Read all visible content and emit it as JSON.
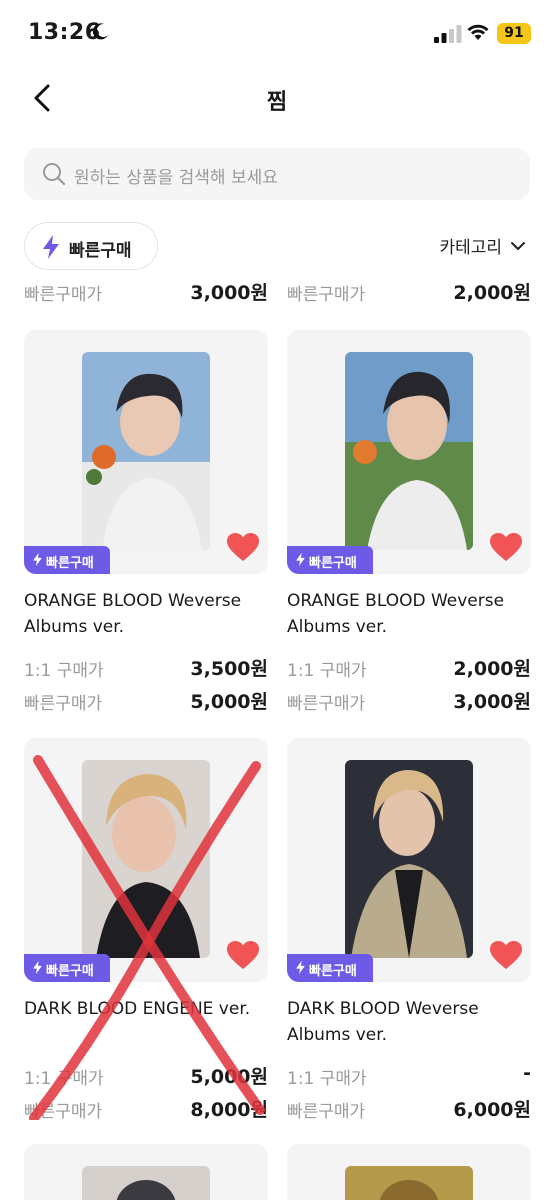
{
  "status": {
    "time": "13:26",
    "battery": "91"
  },
  "nav": {
    "title": "찜"
  },
  "search": {
    "placeholder": "원하는 상품을 검색해 보세요"
  },
  "filter": {
    "quick_buy_label": "빠른구매",
    "category_label": "카테고리"
  },
  "top_partial_row": [
    {
      "label": "빠른구매가",
      "price": "3,000원"
    },
    {
      "label": "빠른구매가",
      "price": "2,000원"
    }
  ],
  "products": [
    {
      "badge": "빠른구매",
      "title": "ORANGE BLOOD Weverse Albums ver.",
      "label_1to1": "1:1 구매가",
      "price_1to1": "3,500원",
      "label_quick": "빠른구매가",
      "price_quick": "5,000원",
      "liked": true
    },
    {
      "badge": "빠른구매",
      "title": "ORANGE BLOOD Weverse Albums ver.",
      "label_1to1": "1:1 구매가",
      "price_1to1": "2,000원",
      "label_quick": "빠른구매가",
      "price_quick": "3,000원",
      "liked": true
    },
    {
      "badge": "빠른구매",
      "title": "DARK BLOOD ENGENE ver.",
      "label_1to1": "1:1 구매가",
      "price_1to1": "5,000원",
      "label_quick": "빠른구매가",
      "price_quick": "8,000원",
      "liked": true,
      "crossed_out": true
    },
    {
      "badge": "빠른구매",
      "title": "DARK BLOOD Weverse Albums ver.",
      "label_1to1": "1:1 구매가",
      "price_1to1": "-",
      "label_quick": "빠른구매가",
      "price_quick": "6,000원",
      "liked": true
    }
  ],
  "colors": {
    "accent": "#6d5ae6",
    "heart": "#f05454",
    "strike": "#e0323c",
    "battery": "#f5c518"
  },
  "icons": [
    "moon-icon",
    "signal-icon",
    "wifi-icon",
    "back-icon",
    "search-icon",
    "bolt-icon",
    "chevron-down-icon",
    "heart-icon"
  ]
}
